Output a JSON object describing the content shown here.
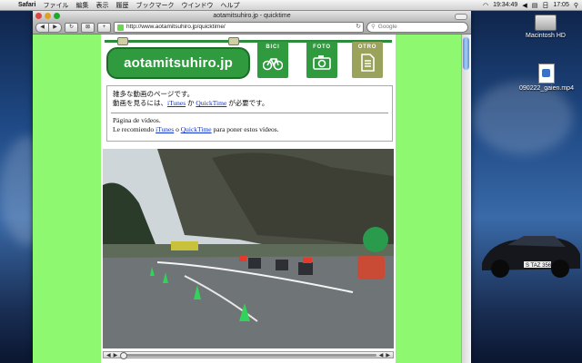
{
  "menubar": {
    "app": "Safari",
    "items": [
      "ファイル",
      "編集",
      "表示",
      "履歴",
      "ブックマーク",
      "ウインドウ",
      "ヘルプ"
    ],
    "clock_day": "日",
    "clock_time": "17:05",
    "status_time": "19:34:49"
  },
  "desktop": {
    "icons": [
      {
        "label": "Macintosh HD"
      },
      {
        "label": "090222_gaien.mp4"
      }
    ]
  },
  "window": {
    "title": "aotamitsuhiro.jp - quicktime",
    "url": "http://www.aotamitsuhiro.jp/quicktime/",
    "search_placeholder": "Google"
  },
  "site": {
    "logo": "aotamitsuhiro.jp",
    "nav": [
      {
        "label": "BICI",
        "icon": "bicycle-icon"
      },
      {
        "label": "FOTO",
        "icon": "camera-icon"
      },
      {
        "label": "OTRO",
        "icon": "document-icon"
      }
    ],
    "jp_line1": "雑多な動画のページです。",
    "jp_line2_pre": "動画を見るには、",
    "jp_link1": "iTunes",
    "jp_mid": " か ",
    "jp_link2": "QuickTime",
    "jp_line2_post": " が必要です。",
    "es_line1": "Página de vídeos.",
    "es_line2_pre": "Le recomiendo ",
    "es_link1": "iTunes",
    "es_mid": " o ",
    "es_link2": "QuickTime",
    "es_line2_post": " para poner estos vídeos."
  },
  "player": {
    "progress": 0
  },
  "colors": {
    "page_bg": "#8ff871",
    "brand_green": "#2f9a3e",
    "shirt_olive": "#9ba25b",
    "link": "#1133cc"
  }
}
